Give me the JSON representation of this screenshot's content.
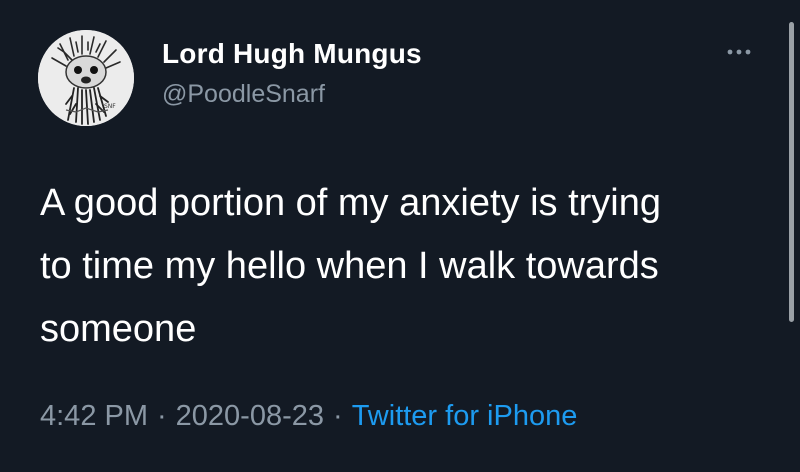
{
  "author": {
    "display_name": "Lord Hugh Mungus",
    "handle": "@PoodleSnarf"
  },
  "tweet": {
    "lines": [
      "A good portion of my anxiety is trying",
      "to time my hello when I walk towards",
      "someone"
    ]
  },
  "meta": {
    "time": "4:42 PM",
    "separator": "·",
    "date": "2020-08-23",
    "source": "Twitter for iPhone"
  },
  "icons": {
    "more": "more-horizontal-icon",
    "avatar": "poodle-drawing-avatar"
  },
  "colors": {
    "background": "#131a24",
    "primary_text": "#ffffff",
    "secondary_text": "#8b98a5",
    "link": "#1d9bf0"
  }
}
